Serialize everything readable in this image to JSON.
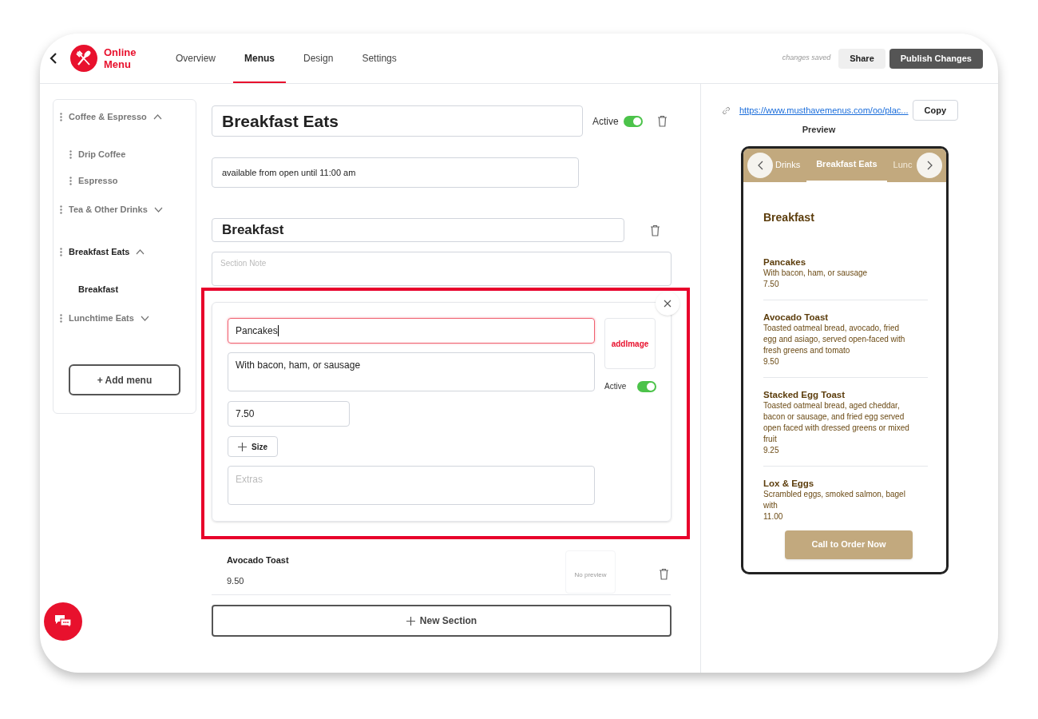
{
  "header": {
    "logo_text": "Online Menu",
    "tabs": [
      {
        "label": "Overview",
        "selected": false
      },
      {
        "label": "Menus",
        "selected": true
      },
      {
        "label": "Design",
        "selected": false
      },
      {
        "label": "Settings",
        "selected": false
      }
    ],
    "status": "changes saved",
    "share_button": "Share",
    "publish_button": "Publish Changes"
  },
  "sidebar": {
    "menus": [
      {
        "label": "Coffee & Espresso",
        "expanded": true,
        "selected": false,
        "children": [
          {
            "label": "Drip Coffee",
            "selected": false
          },
          {
            "label": "Espresso",
            "selected": false
          }
        ]
      },
      {
        "label": "Tea & Other Drinks",
        "expanded": false,
        "selected": false
      },
      {
        "label": "Breakfast Eats",
        "expanded": true,
        "selected": true,
        "children": [
          {
            "label": "Breakfast",
            "selected": true
          }
        ]
      },
      {
        "label": "Lunchtime Eats",
        "expanded": false,
        "selected": false
      }
    ],
    "add_button": "+ Add menu"
  },
  "menu_editor": {
    "title_value": "Breakfast Eats",
    "active_label": "Active",
    "active": true,
    "description_value": "available from open until 11:00 am",
    "section": {
      "name_value": "Breakfast",
      "note_placeholder": "Section Note",
      "item_editor": {
        "name_value": "Pancakes",
        "description_value": "With bacon, ham, or sausage",
        "price_value": "7.50",
        "size_button": "Size",
        "extras_placeholder": "Extras",
        "image_button": "addImage",
        "active_label": "Active",
        "active": true
      },
      "items": [
        {
          "name": "Avocado Toast",
          "price": "9.50",
          "image": "No preview"
        }
      ]
    },
    "new_section_button": "New Section"
  },
  "preview": {
    "url": "https://www.musthavemenus.com/oo/plac...",
    "copy_button": "Copy",
    "title": "Preview",
    "tabs": [
      {
        "label": "Drinks",
        "selected": false
      },
      {
        "label": "Breakfast Eats",
        "selected": true
      },
      {
        "label": "Lunc",
        "selected": false
      }
    ],
    "section_title": "Breakfast",
    "items": [
      {
        "name": "Pancakes",
        "description": "With bacon, ham, or sausage",
        "price": "7.50"
      },
      {
        "name": "Avocado Toast",
        "description": "Toasted oatmeal bread, avocado, fried egg and asiago, served open-faced with fresh greens and tomato",
        "price": "9.50"
      },
      {
        "name": "Stacked Egg Toast",
        "description": "Toasted oatmeal bread, aged cheddar, bacon or sausage, and fried egg served open faced with dressed greens or mixed fruit",
        "price": "9.25"
      },
      {
        "name": "Lox & Eggs",
        "description": "Scrambled eggs, smoked salmon, bagel with",
        "price": "11.00"
      }
    ],
    "order_button": "Call to Order Now"
  }
}
